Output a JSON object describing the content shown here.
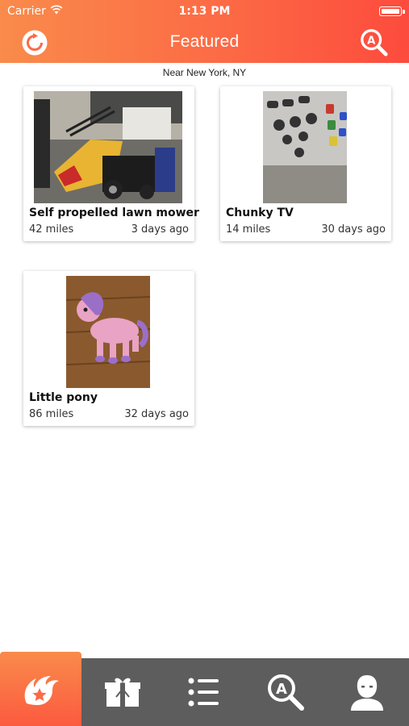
{
  "status_bar": {
    "carrier": "Carrier",
    "time": "1:13 PM"
  },
  "header": {
    "title": "Featured",
    "left_icon": "refresh-icon",
    "right_icon": "search-icon"
  },
  "location": "Near New York, NY",
  "listings": [
    {
      "title": "Self propelled lawn mower",
      "distance": "42 miles",
      "age": "3 days ago"
    },
    {
      "title": "Chunky TV",
      "distance": "14 miles",
      "age": "30 days ago"
    },
    {
      "title": "Little pony",
      "distance": "86 miles",
      "age": "32 days ago"
    }
  ],
  "tabs": [
    {
      "icon": "featured-star-icon",
      "active": true
    },
    {
      "icon": "gift-box-icon",
      "active": false
    },
    {
      "icon": "list-icon",
      "active": false
    },
    {
      "icon": "search-icon",
      "active": false
    },
    {
      "icon": "profile-icon",
      "active": false
    }
  ],
  "colors": {
    "accent_start": "#f98b4b",
    "accent_end": "#fd4b3d",
    "tabbar": "#5d5d5d"
  }
}
